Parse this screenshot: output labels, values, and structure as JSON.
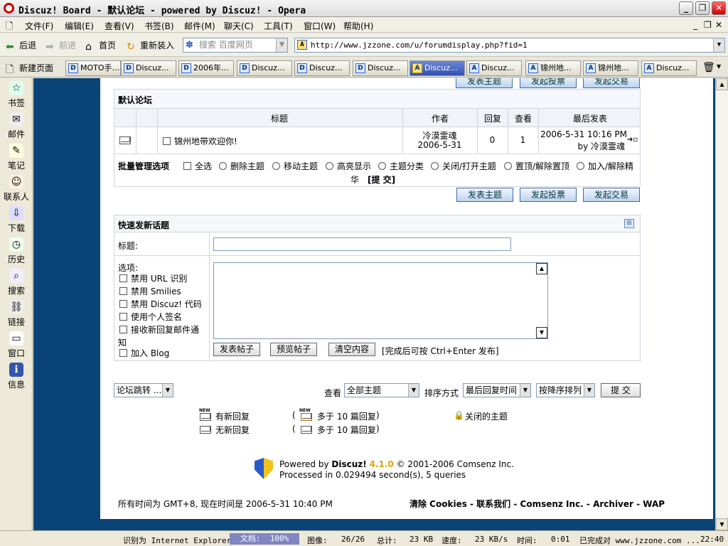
{
  "window": {
    "title": "Discuz! Board - 默认论坛 - powered by Discuz! - Opera"
  },
  "menu": [
    "文件(F)",
    "编辑(E)",
    "查看(V)",
    "书签(B)",
    "邮件(M)",
    "聊天(C)",
    "工具(T)",
    "窗口(W)",
    "帮助(H)"
  ],
  "toolbar": {
    "back": "后退",
    "forward": "前进",
    "home": "首页",
    "reload": "重新装入",
    "search_placeholder": "搜索 百度网页",
    "url": "http://www.jzzone.com/u/forumdisplay.php?fid=1"
  },
  "tabs": {
    "newpage": "新建页面",
    "items": [
      "MOTO手...",
      "Discuz...",
      "2006年...",
      "Discuz...",
      "Discuz...",
      "Discuz...",
      "Discuz...",
      "Discuz...",
      "锦州地...",
      "锦州地...",
      "Discuz..."
    ]
  },
  "sidebar": [
    "书签",
    "邮件",
    "笔记",
    "联系人",
    "下载",
    "历史",
    "搜索",
    "链接",
    "窗口",
    "信息"
  ],
  "forum": {
    "top_buttons": [
      "发表主题",
      "发起投票",
      "发起交易"
    ],
    "section_title": "默认论坛",
    "columns": {
      "title": "标题",
      "author": "作者",
      "replies": "回复",
      "views": "查看",
      "last": "最后发表"
    },
    "threads": [
      {
        "title": "锦州地带欢迎你!",
        "author": "冷漠霊魂",
        "date": "2006-5-31",
        "replies": "0",
        "views": "1",
        "last_time": "2006-5-31 10:16 PM",
        "last_by": "by 冷漠霊魂"
      }
    ],
    "batch": {
      "label": "批量管理选项",
      "select_all": "全选",
      "options": [
        "删除主题",
        "移动主题",
        "高亮显示",
        "主题分类",
        "关闭/打开主题",
        "置顶/解除置顶",
        "加入/解除精"
      ],
      "wrap": "华",
      "submit": "[提 交]"
    },
    "bottom_buttons": [
      "发表主题",
      "发起投票",
      "发起交易"
    ]
  },
  "quickpost": {
    "heading": "快速发新话题",
    "subject_label": "标题:",
    "options_label": "选项:",
    "options": [
      "禁用 URL 识别",
      "禁用 Smilies",
      "禁用 Discuz! 代码",
      "使用个人签名",
      "接收新回复邮件通"
    ],
    "options_wrap": "知",
    "blog": "加入 Blog",
    "buttons": [
      "发表帖子",
      "预览帖子",
      "清空内容"
    ],
    "hint": "[完成后可按 Ctrl+Enter 发布]"
  },
  "filters": {
    "jump": "论坛跳转 ...",
    "view_label": "查看",
    "view_value": "全部主题",
    "sort_label": "排序方式",
    "sort_value": "最后回复时间",
    "order_value": "按降序排列",
    "submit": "提  交"
  },
  "legend": {
    "new": "有新回复",
    "nonew": "无新回复",
    "hot_new": "多于 10 篇回复",
    "hot": "多于 10 篇回复",
    "lparen": "(",
    "rparen": ")",
    "closed": "关闭的主题",
    "new_tag": "NEW"
  },
  "footer": {
    "powered_prefix": "Powered by",
    "brand": "Discuz!",
    "version": "4.1.0",
    "copyright": "© 2001-2006 Comsenz Inc.",
    "processed": "Processed in 0.029494 second(s), 5 queries",
    "time": "所有时间为 GMT+8, 现在时间是 2006-5-31 10:40 PM",
    "links": "清除 Cookies - 联系我们 - Comsenz Inc. - Archiver - WAP"
  },
  "status": {
    "ident": "识别为 Internet Explorer",
    "doc": "文档:",
    "doc_pct": "100%",
    "images_label": "图像:",
    "images": "26/26",
    "total_label": "总计:",
    "total": "23 KB",
    "speed_label": "速度:",
    "speed": "23 KB/s",
    "time_label": "时间:",
    "time": "0:01",
    "done": "已完成对 www.jzzone.com ...",
    "clock": "22:40"
  }
}
